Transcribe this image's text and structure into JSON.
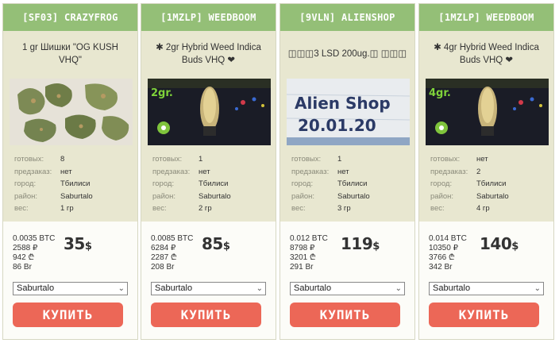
{
  "colors": {
    "header": "#94bf77",
    "card_top": "#e8e7d0",
    "buy_button": "#ec6757"
  },
  "spec_labels": {
    "stock": "готовых:",
    "preorder": "предзаказ:",
    "city": "город:",
    "district": "район:",
    "weight": "вес:"
  },
  "buy_label": "КУПИТЬ",
  "cards": [
    {
      "shop": "[SF03] CRAZYFROG",
      "title": "1 gr Шишки \"OG KUSH VHQ\"",
      "photo_text": "",
      "stock": "8",
      "preorder": "нет",
      "city": "Тбилиси",
      "district": "Saburtalo",
      "weight": "1 гр",
      "btc": "0.0035 BTC",
      "rub": "2588 ₽",
      "gel": "942 ₾",
      "byn": "86 Br",
      "usd_num": "35",
      "usd_cur": "$",
      "select_value": "Saburtalo"
    },
    {
      "shop": "[1MZLP] WEEDBOOM",
      "title": "✱ 2gr Hybrid Weed Indica Buds VHQ ❤",
      "photo_text": "2gr.",
      "stock": "1",
      "preorder": "нет",
      "city": "Тбилиси",
      "district": "Saburtalo",
      "weight": "2 гр",
      "btc": "0.0085 BTC",
      "rub": "6284 ₽",
      "gel": "2287 ₾",
      "byn": "208 Br",
      "usd_num": "85",
      "usd_cur": "$",
      "select_value": "Saburtalo"
    },
    {
      "shop": "[9VLN] ALIENSHOP",
      "title": "◫◫◫3 LSD 200ug.◫ ◫◫◫",
      "photo_text": "Alien Shop",
      "photo_text2": "20.01.20",
      "stock": "1",
      "preorder": "нет",
      "city": "Тбилиси",
      "district": "Saburtalo",
      "weight": "3 гр",
      "btc": "0.012 BTC",
      "rub": "8798 ₽",
      "gel": "3201 ₾",
      "byn": "291 Br",
      "usd_num": "119",
      "usd_cur": "$",
      "select_value": "Saburtalo"
    },
    {
      "shop": "[1MZLP] WEEDBOOM",
      "title": "✱ 4gr Hybrid Weed Indica Buds VHQ ❤",
      "photo_text": "4gr.",
      "stock": "нет",
      "preorder": "2",
      "city": "Тбилиси",
      "district": "Saburtalo",
      "weight": "4 гр",
      "btc": "0.014 BTC",
      "rub": "10350 ₽",
      "gel": "3766 ₾",
      "byn": "342 Br",
      "usd_num": "140",
      "usd_cur": "$",
      "select_value": "Saburtalo"
    }
  ]
}
